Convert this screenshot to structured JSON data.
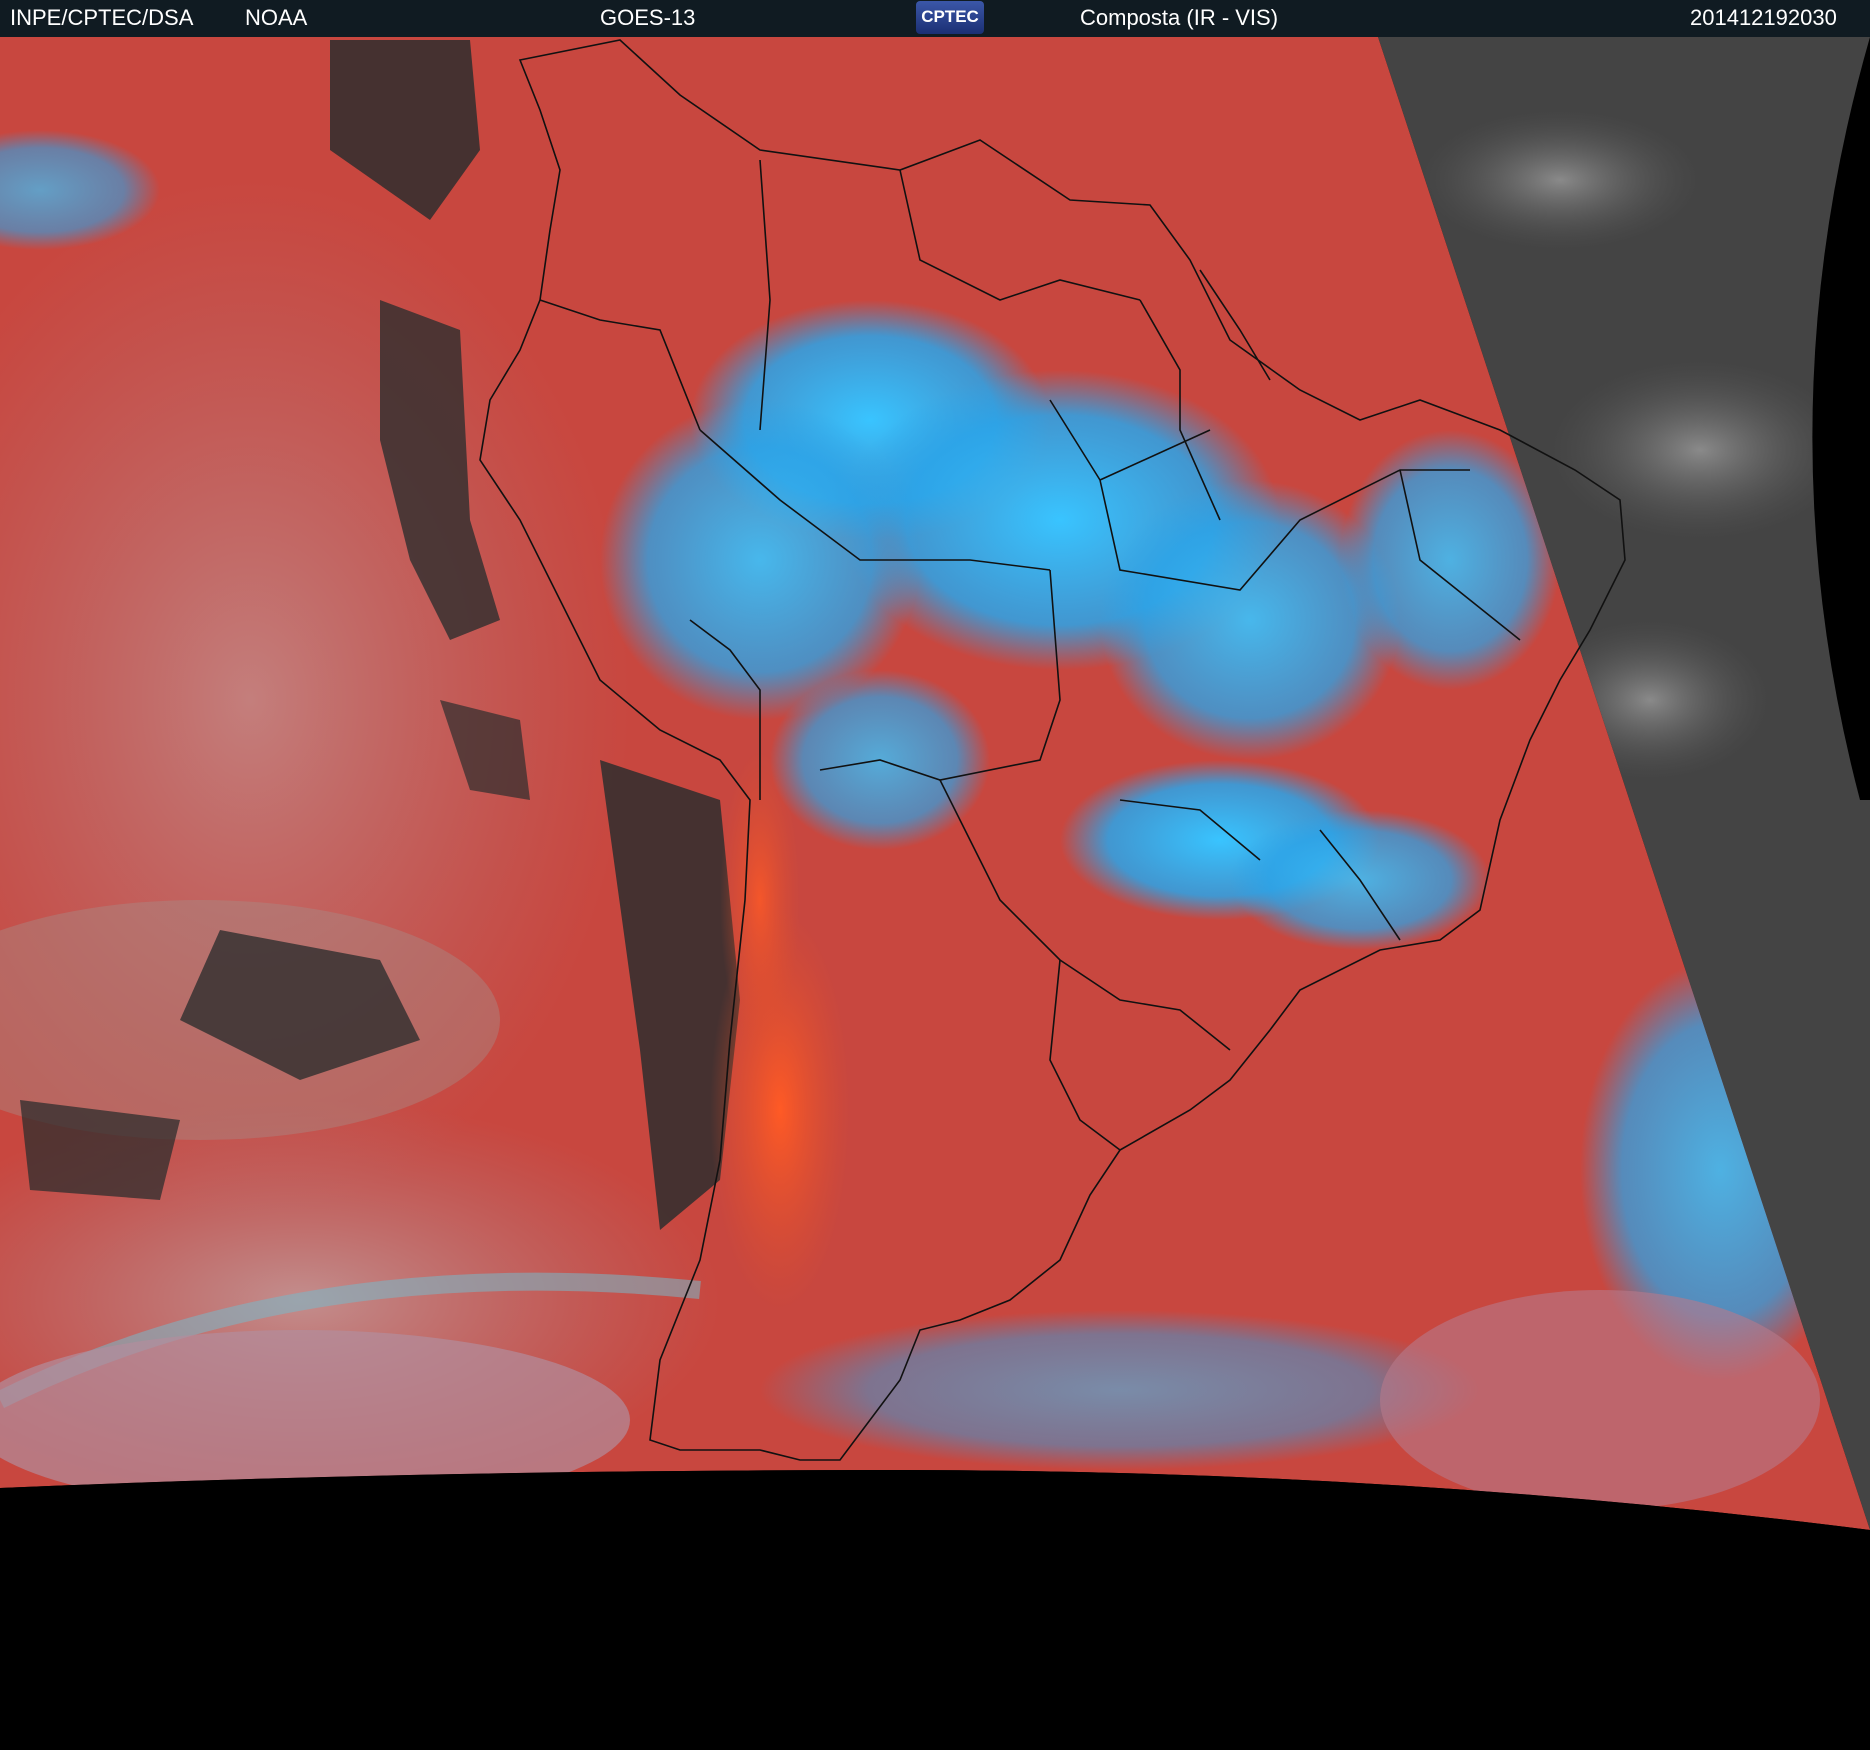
{
  "header": {
    "agency": "INPE/CPTEC/DSA",
    "partner": "NOAA",
    "satellite": "GOES-13",
    "logo_text": "CPTEC",
    "product": "Composta (IR - VIS)",
    "timestamp": "201412192030"
  },
  "colors": {
    "header_bg": "#101b22",
    "background": "#000000",
    "land_ir": "#c8473f",
    "cloud_cold": "#2fb0f0",
    "clear_dark": "#2a2a2a",
    "night_gray": "#4a4a4a"
  }
}
